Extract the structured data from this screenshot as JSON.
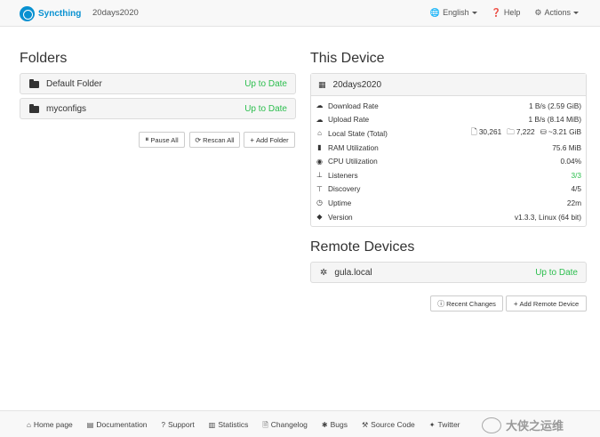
{
  "navbar": {
    "brand": "Syncthing",
    "device_name": "20days2020",
    "language_label": "English",
    "help_label": "Help",
    "actions_label": "Actions"
  },
  "folders": {
    "heading": "Folders",
    "items": [
      {
        "name": "Default Folder",
        "status": "Up to Date"
      },
      {
        "name": "myconfigs",
        "status": "Up to Date"
      }
    ],
    "buttons": {
      "pause_all": "Pause All",
      "rescan_all": "Rescan All",
      "add_folder": "Add Folder"
    }
  },
  "this_device": {
    "heading": "This Device",
    "name": "20days2020",
    "rows": [
      {
        "icon": "cloud-download-icon",
        "label": "Download Rate",
        "value": "1 B/s (2.59 GiB)"
      },
      {
        "icon": "cloud-upload-icon",
        "label": "Upload Rate",
        "value": "1 B/s (8.14 MiB)"
      },
      {
        "icon": "home-icon",
        "label": "Local State (Total)",
        "value": ""
      },
      {
        "icon": "ram-icon",
        "label": "RAM Utilization",
        "value": "75.6 MiB"
      },
      {
        "icon": "cpu-icon",
        "label": "CPU Utilization",
        "value": "0.04%"
      },
      {
        "icon": "sitemap-icon",
        "label": "Listeners",
        "value": "3/3"
      },
      {
        "icon": "signpost-icon",
        "label": "Discovery",
        "value": "4/5"
      },
      {
        "icon": "clock-icon",
        "label": "Uptime",
        "value": "22m"
      },
      {
        "icon": "tag-icon",
        "label": "Version",
        "value": "v1.3.3, Linux (64 bit)"
      }
    ],
    "local_state": {
      "files": "30,261",
      "folders": "7,222",
      "size": "~3.21 GiB"
    }
  },
  "remote_devices": {
    "heading": "Remote Devices",
    "items": [
      {
        "name": "gula.local",
        "status": "Up to Date"
      }
    ],
    "buttons": {
      "recent_changes": "Recent Changes",
      "add_remote_device": "Add Remote Device"
    }
  },
  "footer": {
    "links": [
      "Home page",
      "Documentation",
      "Support",
      "Statistics",
      "Changelog",
      "Bugs",
      "Source Code",
      "Twitter"
    ],
    "watermark": "大侠之运维"
  }
}
